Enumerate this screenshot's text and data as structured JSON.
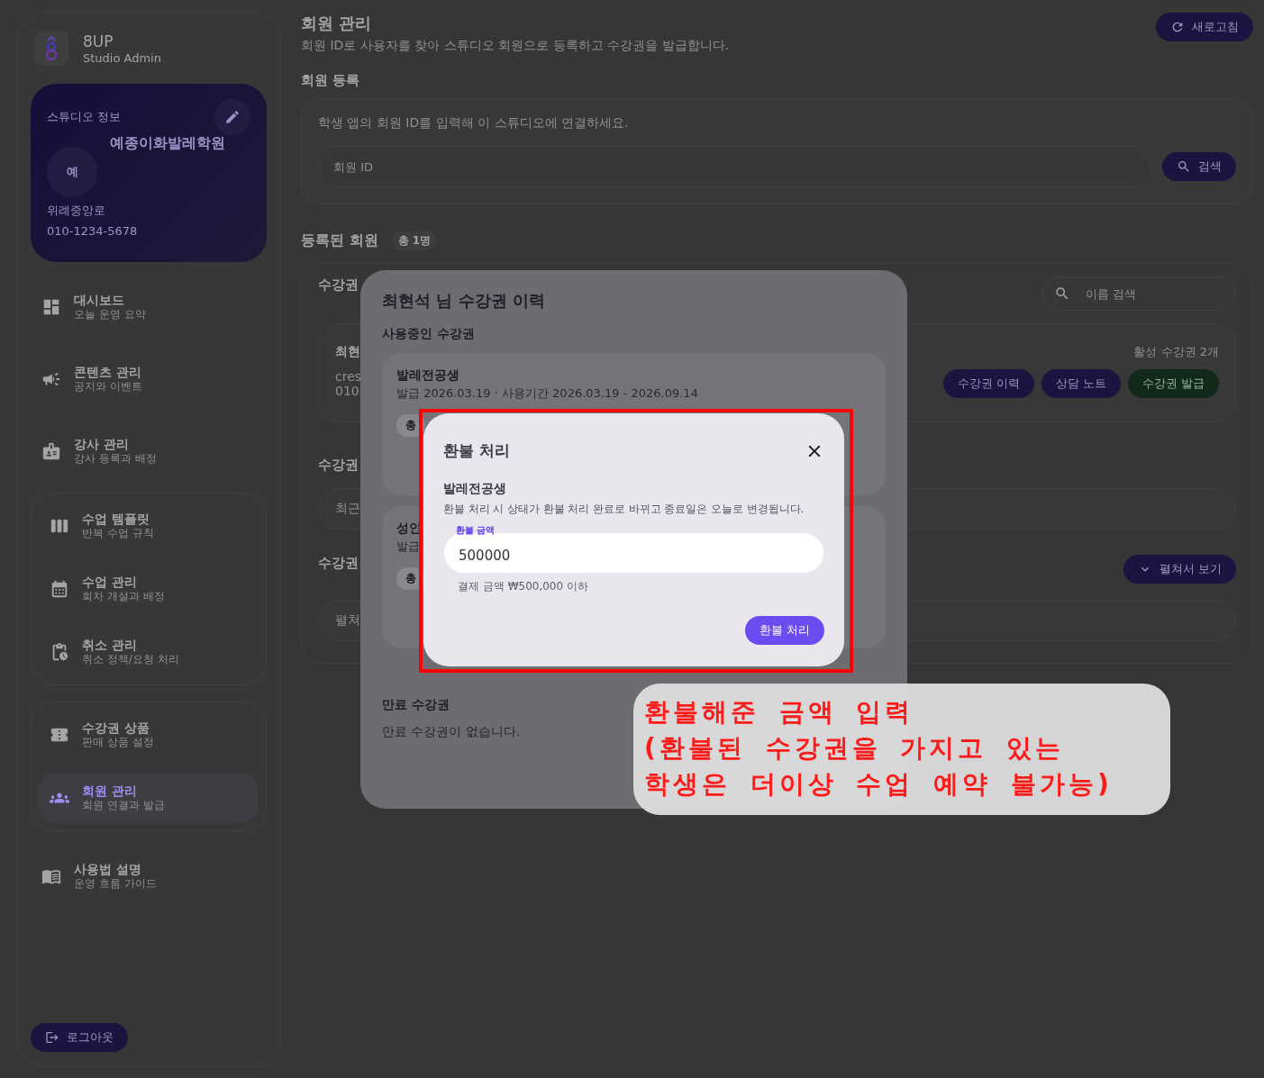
{
  "sidebar": {
    "brand": {
      "name": "8UP",
      "subtitle": "Studio Admin"
    },
    "studio_card": {
      "heading": "스튜디오 정보",
      "avatar": "예",
      "name": "예종이화발레학원",
      "address": "위례중앙로",
      "phone": "010-1234-5678"
    },
    "nav_sections": [
      {
        "kind": "plain",
        "items": [
          {
            "label": "대시보드",
            "caption": "오늘 운영 요약",
            "selected": false
          },
          {
            "label": "콘텐츠 관리",
            "caption": "공지와 이벤트",
            "selected": false
          },
          {
            "label": "강사 관리",
            "caption": "강사 등록과 배정",
            "selected": false
          }
        ]
      },
      {
        "kind": "group",
        "items": [
          {
            "label": "수업 템플릿",
            "caption": "반복 수업 규칙",
            "selected": false
          },
          {
            "label": "수업 관리",
            "caption": "회차 개설과 배정",
            "selected": false
          },
          {
            "label": "취소 관리",
            "caption": "취소 정책/요청 처리",
            "selected": false
          }
        ]
      },
      {
        "kind": "group",
        "items": [
          {
            "label": "수강권 상품",
            "caption": "판매 상품 설정",
            "selected": false
          },
          {
            "label": "회원 관리",
            "caption": "회원 연결과 발급",
            "selected": true
          }
        ]
      },
      {
        "kind": "plain",
        "items": [
          {
            "label": "사용법 설명",
            "caption": "운영 흐름 가이드",
            "selected": false
          }
        ]
      }
    ],
    "logout_button": "로그아웃"
  },
  "header": {
    "title": "회원 관리",
    "subtitle": "회원 ID로 사용자를 찾아 스튜디오 회원으로 등록하고 수강권을 발급합니다.",
    "refresh_button": "새로고침"
  },
  "register": {
    "heading": "회원 등록",
    "hint": "학생 앱의 회원 ID를 입력해 이 스튜디오에 연결하세요.",
    "placeholder": "회원 ID",
    "search_button": "검색"
  },
  "members": {
    "heading": "등록된 회원",
    "count": "총 1명",
    "section_label": "수강권",
    "search_placeholder": "이름 검색",
    "member_card": {
      "name": "최현",
      "line_1": "cres",
      "line_2": "010",
      "active_count": "활성 수강권 2개",
      "buttons": [
        {
          "label": "수강권 이력",
          "kind": "primary"
        },
        {
          "label": "상담 노트",
          "kind": "primary"
        },
        {
          "label": "수강권 발급",
          "kind": "success"
        }
      ]
    },
    "section_2": {
      "label": "수강권",
      "text": "최근"
    },
    "section_3": {
      "label": "수강권",
      "text": "펼쳐",
      "expand_button": "펼쳐서 보기"
    }
  },
  "history_dialog": {
    "title": "최현석 님 수강권 이력",
    "active_heading": "사용중인 수강권",
    "tickets": [
      {
        "name": "발레전공생",
        "meta": "발급 2026.03.19 · 사용기간 2026.03.19 - 2026.09.14",
        "chip": "총"
      },
      {
        "name": "성인",
        "meta": "발급",
        "chip": "총"
      }
    ],
    "expired_heading": "만료 수강권",
    "expired_empty": "만료 수강권이 없습니다."
  },
  "refund_modal": {
    "title": "환불 처리",
    "ticket": "발레전공생",
    "notice": "환불 처리 시 상태가 환불 처리 완료로 바뀌고 종료일은 오늘로 변경됩니다.",
    "field_label": "환불 금액",
    "value": "500000",
    "helper": "결제 금액 ₩500,000 이하",
    "submit_button": "환불 처리"
  },
  "annotation": {
    "lines": [
      "환불해준 금액 입력",
      "(환불된 수강권을 가지고 있는",
      "학생은 더이상 수업 예약 불가능)"
    ]
  }
}
